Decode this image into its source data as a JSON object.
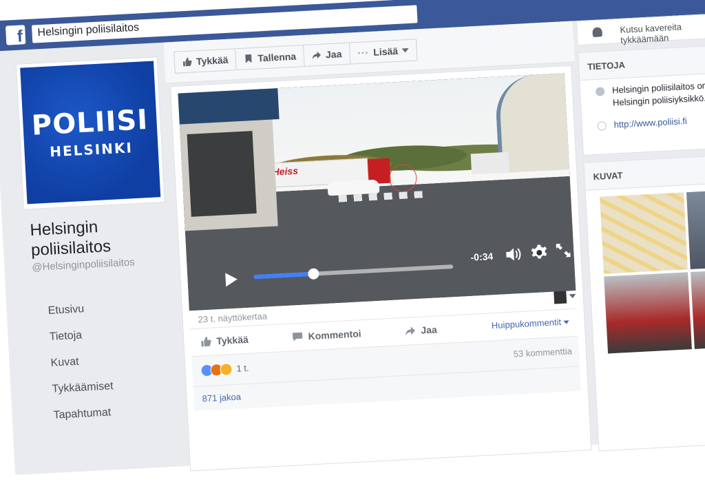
{
  "browser": {
    "search_value": "Helsingin poliisilaitos"
  },
  "page": {
    "profile_title": "POLIISI",
    "profile_subtitle": "HELSINKI",
    "name": "Helsingin poliisilaitos",
    "handle": "@Helsinginpoliisilaitos"
  },
  "nav": {
    "items": [
      {
        "label": "Etusivu"
      },
      {
        "label": "Tietoja"
      },
      {
        "label": "Kuvat"
      },
      {
        "label": "Tykkäämiset"
      },
      {
        "label": "Tapahtumat"
      }
    ]
  },
  "actionbar": {
    "like": "Tykkää",
    "save": "Tallenna",
    "share": "Jaa",
    "more": "Lisää"
  },
  "video": {
    "time_remaining": "-0:34",
    "progress_fraction": 0.3,
    "truck_text": "Heiss"
  },
  "post": {
    "views": "23 t. näyttökertaa",
    "like": "Tykkää",
    "comment": "Kommentoi",
    "share": "Jaa",
    "top_comments": "Huippukommentit",
    "reactions_count": "1 t.",
    "comments_count": "53 kommenttia",
    "shares": "871 jakoa"
  },
  "right": {
    "invite_text": "Kutsu kavereita tykkäämään",
    "info": {
      "title": "TIETOJA",
      "description": "Helsingin poliisilaitos on Helsingin poliisiyksikkö.",
      "link": "http://www.poliisi.fi"
    },
    "photos": {
      "title": "KUVAT"
    }
  },
  "colors": {
    "facebook_blue": "#3b5998",
    "link_blue": "#4267b2",
    "progress_blue": "#4080ff",
    "police_blue": "#1d58c8"
  }
}
